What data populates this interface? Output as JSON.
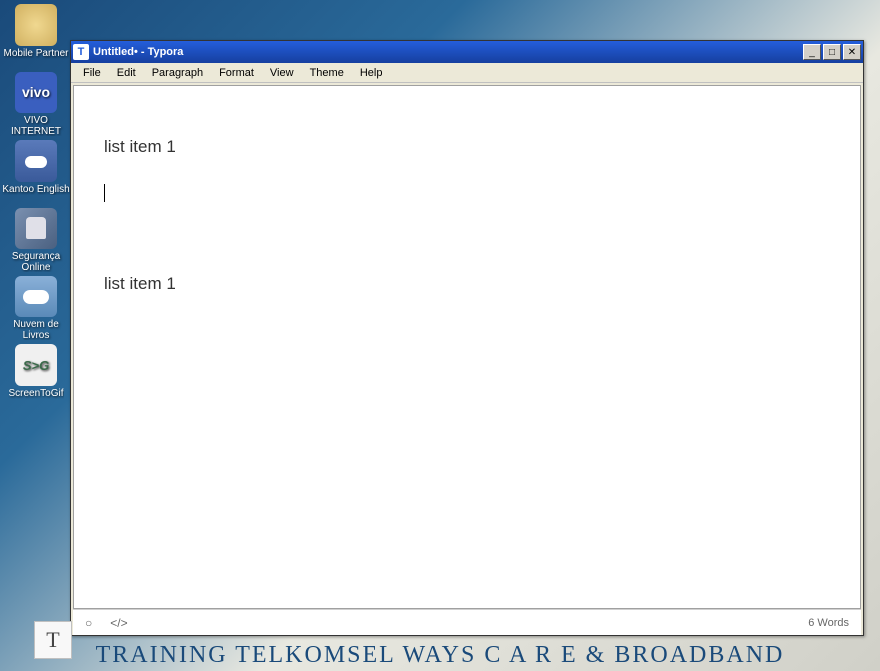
{
  "desktop": {
    "icons": [
      {
        "label": "Mobile Partner",
        "kind": "mobile"
      },
      {
        "label": "VIVO INTERNET",
        "kind": "vivo",
        "badge": "vivo"
      },
      {
        "label": "Kantoo English",
        "kind": "kantoo"
      },
      {
        "label": "Segurança Online",
        "kind": "seguranca"
      },
      {
        "label": "Nuvem de Livros",
        "kind": "nuvem"
      },
      {
        "label": "ScreenToGif",
        "kind": "screen",
        "badge": "S>G"
      }
    ],
    "background_text": "TRAINING  TELKOMSEL  WAYS   C A R E   &   BROADBAND"
  },
  "window": {
    "title": "Untitled• - Typora",
    "app_glyph": "T",
    "buttons": {
      "minimize": "_",
      "maximize": "□",
      "close": "✕"
    },
    "menu": [
      "File",
      "Edit",
      "Paragraph",
      "Format",
      "View",
      "Theme",
      "Help"
    ],
    "document": {
      "paragraphs": [
        "list item 1",
        "",
        "",
        "list item 1"
      ],
      "cursor_paragraph_index": 1
    },
    "statusbar": {
      "outline_icon": "○",
      "source_icon": "</>",
      "wordcount": "6 Words"
    }
  },
  "taskbar": {
    "app_glyph": "T"
  }
}
